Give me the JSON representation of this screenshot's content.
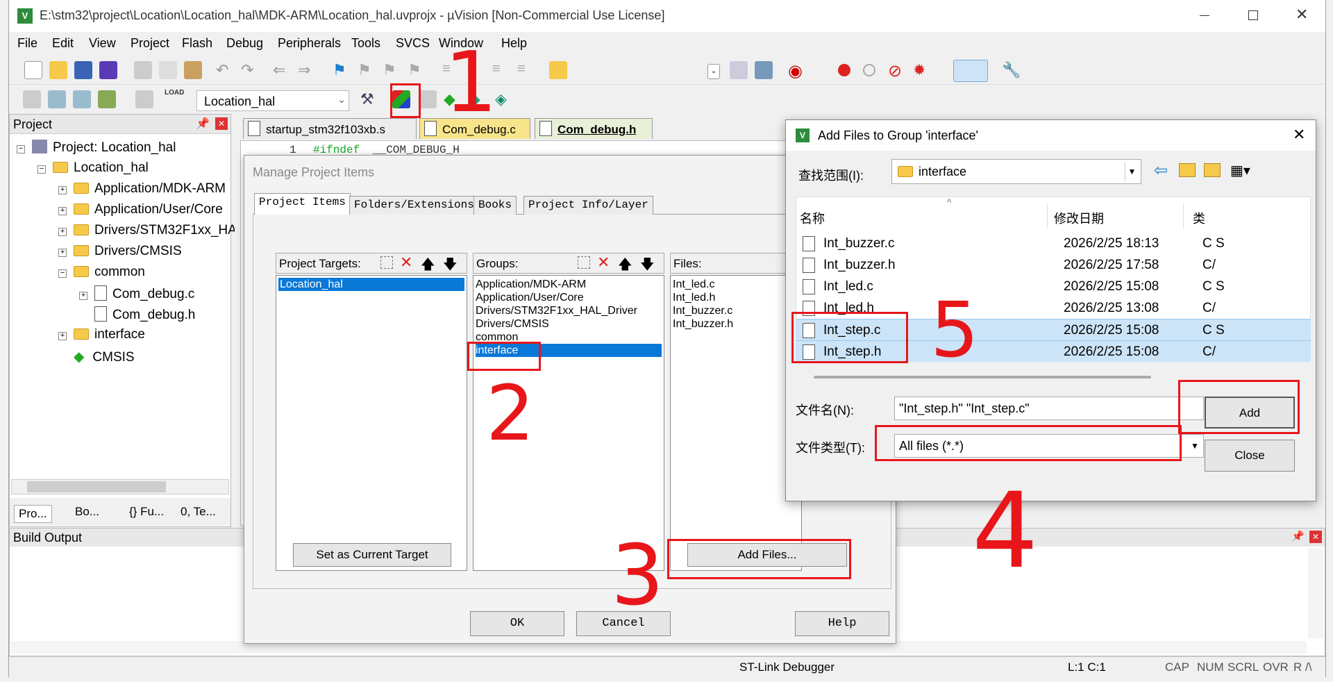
{
  "window": {
    "title": "E:\\stm32\\project\\Location\\Location_hal\\MDK-ARM\\Location_hal.uvprojx - µVision  [Non-Commercial Use License]"
  },
  "menu": [
    "File",
    "Edit",
    "View",
    "Project",
    "Flash",
    "Debug",
    "Peripherals",
    "Tools",
    "SVCS",
    "Window",
    "Help"
  ],
  "toolbar": {
    "target": "Location_hal"
  },
  "project_panel": {
    "title": "Project",
    "root": "Project: Location_hal",
    "target": "Location_hal",
    "groups": [
      "Application/MDK-ARM",
      "Application/User/Core",
      "Drivers/STM32F1xx_HAL",
      "Drivers/CMSIS",
      "common",
      "Com_debug.c",
      "Com_debug.h",
      "interface",
      "CMSIS"
    ],
    "tabs": [
      "Pro...",
      "Bo...",
      "{} Fu...",
      "0, Te..."
    ]
  },
  "editor": {
    "tabs": [
      "startup_stm32f103xb.s",
      "Com_debug.c",
      "Com_debug.h"
    ],
    "line_no": "1",
    "code_kw": "#ifndef",
    "code_rest": "__COM_DEBUG_H"
  },
  "build_output": {
    "title": "Build Output"
  },
  "status": {
    "debugger": "ST-Link Debugger",
    "pos": "L:1 C:1",
    "caps": "CAP",
    "num": "NUM",
    "scrl": "SCRL",
    "ovr": "OVR",
    "rw": "R /\\"
  },
  "manage": {
    "title": "Manage Project Items",
    "tabs": [
      "Project Items",
      "Folders/Extensions",
      "Books",
      "Project Info/Layer"
    ],
    "targets_label": "Project Targets:",
    "targets": [
      "Location_hal"
    ],
    "groups_label": "Groups:",
    "groups": [
      "Application/MDK-ARM",
      "Application/User/Core",
      "Drivers/STM32F1xx_HAL_Driver",
      "Drivers/CMSIS",
      "common",
      "interface"
    ],
    "files_label": "Files:",
    "files": [
      "Int_led.c",
      "Int_led.h",
      "Int_buzzer.c",
      "Int_buzzer.h"
    ],
    "set_target": "Set as Current Target",
    "add_files": "Add Files...",
    "ok": "OK",
    "cancel": "Cancel",
    "help": "Help"
  },
  "addfiles": {
    "title": "Add Files to Group 'interface'",
    "lookin_label": "查找范围(I):",
    "lookin_value": "interface",
    "col_name": "名称",
    "col_date": "修改日期",
    "col_type": "类",
    "rows": [
      {
        "name": "Int_buzzer.c",
        "date": "2026/2/25 18:13",
        "type": "C S"
      },
      {
        "name": "Int_buzzer.h",
        "date": "2026/2/25 17:58",
        "type": "C/"
      },
      {
        "name": "Int_led.c",
        "date": "2026/2/25 15:08",
        "type": "C S"
      },
      {
        "name": "Int_led.h",
        "date": "2026/2/25 13:08",
        "type": "C/"
      },
      {
        "name": "Int_step.c",
        "date": "2026/2/25 15:08",
        "type": "C S"
      },
      {
        "name": "Int_step.h",
        "date": "2026/2/25 15:08",
        "type": "C/"
      }
    ],
    "filename_label": "文件名(N):",
    "filename_value": "\"Int_step.h\" \"Int_step.c\"",
    "filetype_label": "文件类型(T):",
    "filetype_value": "All files (*.*)",
    "add": "Add",
    "close": "Close"
  },
  "annotations": [
    "1",
    "2",
    "3",
    "4",
    "5"
  ],
  "colors": {
    "selection": "#0a78d7",
    "annotation": "#e8161a",
    "file_selected": "#cce4f7"
  }
}
